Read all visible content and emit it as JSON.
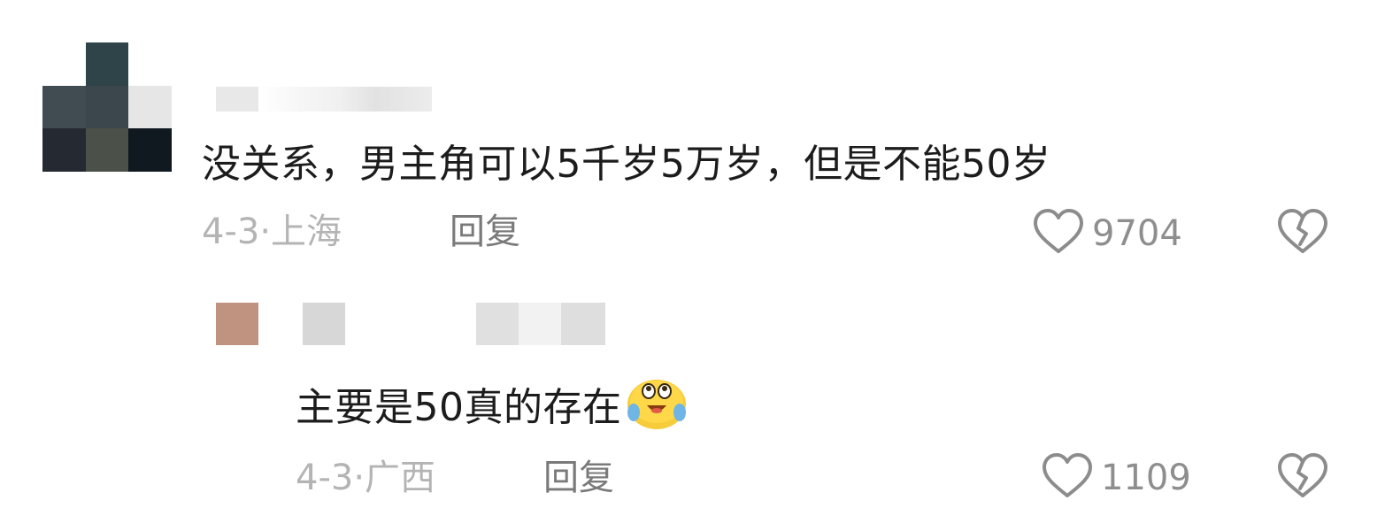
{
  "comments": [
    {
      "text": "没关系，男主角可以5千岁5万岁，但是不能50岁",
      "date": "4-3·",
      "location": "上海",
      "reply_label": "回复",
      "likes": "9704",
      "avatar_pixels": [
        "#ffffff",
        "#2f4448",
        "#ffffff",
        "#404c52",
        "#3b474c",
        "#e6e6e6",
        "#252a32",
        "#4b5048",
        "#101820"
      ]
    },
    {
      "text": "主要是50真的存在",
      "emoji": "crying-laughing-emoji",
      "date": "4-3·",
      "location": "广西",
      "reply_label": "回复",
      "likes": "1109",
      "avatar_color": "#c09280"
    }
  ],
  "icons": {
    "like": "heart-outline-icon",
    "dislike": "broken-heart-icon"
  },
  "colors": {
    "text": "#1c1c1c",
    "meta": "#b4b4b4",
    "reply": "#7a7a7a",
    "count": "#8e8e8e",
    "icon": "#8c8c8c"
  }
}
